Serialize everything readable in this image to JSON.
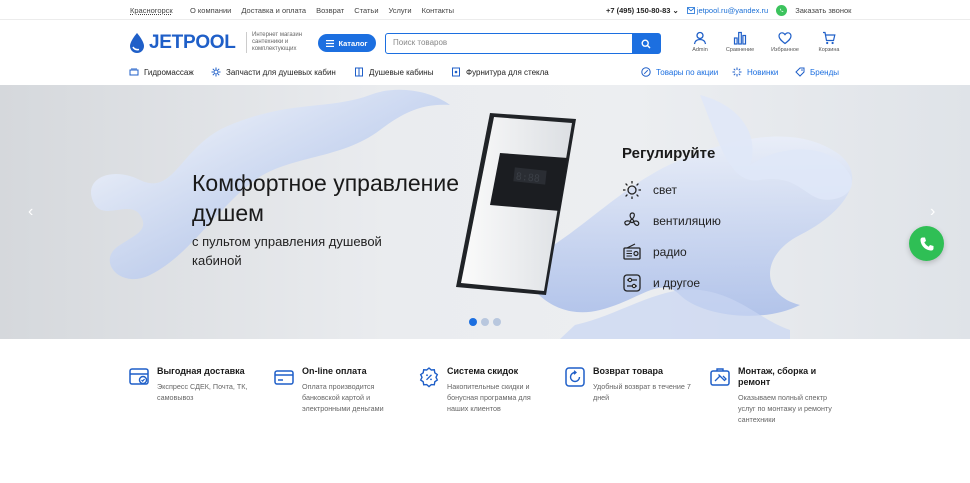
{
  "topbar": {
    "city": "Красногорск",
    "links": [
      "О компании",
      "Доставка и оплата",
      "Возврат",
      "Статьи",
      "Услуги",
      "Контакты"
    ],
    "phone": "+7 (495) 150-80-83",
    "email": "jetpool.ru@yandex.ru",
    "callback": "Заказать звонок"
  },
  "header": {
    "logo": "JETPOOL",
    "tagline": "Интернет магазин сантехники и комплектующих",
    "catalog": "Каталог",
    "search_placeholder": "Поиск товаров",
    "icons": [
      {
        "label": "Admin",
        "icon": "user-icon"
      },
      {
        "label": "Сравнение",
        "icon": "compare-icon"
      },
      {
        "label": "Избранное",
        "icon": "heart-icon"
      },
      {
        "label": "Корзина",
        "icon": "cart-icon"
      }
    ]
  },
  "nav": {
    "items": [
      "Гидромассаж",
      "Запчасти для душевых кабин",
      "Душевые кабины",
      "Фурнитура для стекла"
    ],
    "special": [
      "Товары по акции",
      "Новинки",
      "Бренды"
    ]
  },
  "hero": {
    "title": "Комфортное управление душем",
    "subtitle": "с пультом управления душевой кабиной",
    "features_title": "Регулируйте",
    "features": [
      {
        "label": "свет",
        "icon": "sun-icon"
      },
      {
        "label": "вентиляцию",
        "icon": "fan-icon"
      },
      {
        "label": "радио",
        "icon": "radio-icon"
      },
      {
        "label": "и другое",
        "icon": "settings-icon"
      }
    ],
    "slides": 3,
    "active_slide": 1
  },
  "benefits": [
    {
      "title": "Выгодная доставка",
      "text": "Экспресс СДЕК, Почта, ТК, самовывоз",
      "icon": "delivery-icon"
    },
    {
      "title": "On-line оплата",
      "text": "Оплата производится банковской картой и электронными деньгами",
      "icon": "card-icon"
    },
    {
      "title": "Система скидок",
      "text": "Накопительные скидки и бонусная программа для наших клиентов",
      "icon": "discount-icon"
    },
    {
      "title": "Возврат товара",
      "text": "Удобный возврат в течение 7 дней",
      "icon": "return-icon"
    },
    {
      "title": "Монтаж, сборка и ремонт",
      "text": "Оказываем полный спектр услуг по монтажу и ремонту сантехники",
      "icon": "tools-icon"
    }
  ],
  "colors": {
    "accent": "#1c6fe0",
    "whatsapp": "#2fbf55"
  }
}
